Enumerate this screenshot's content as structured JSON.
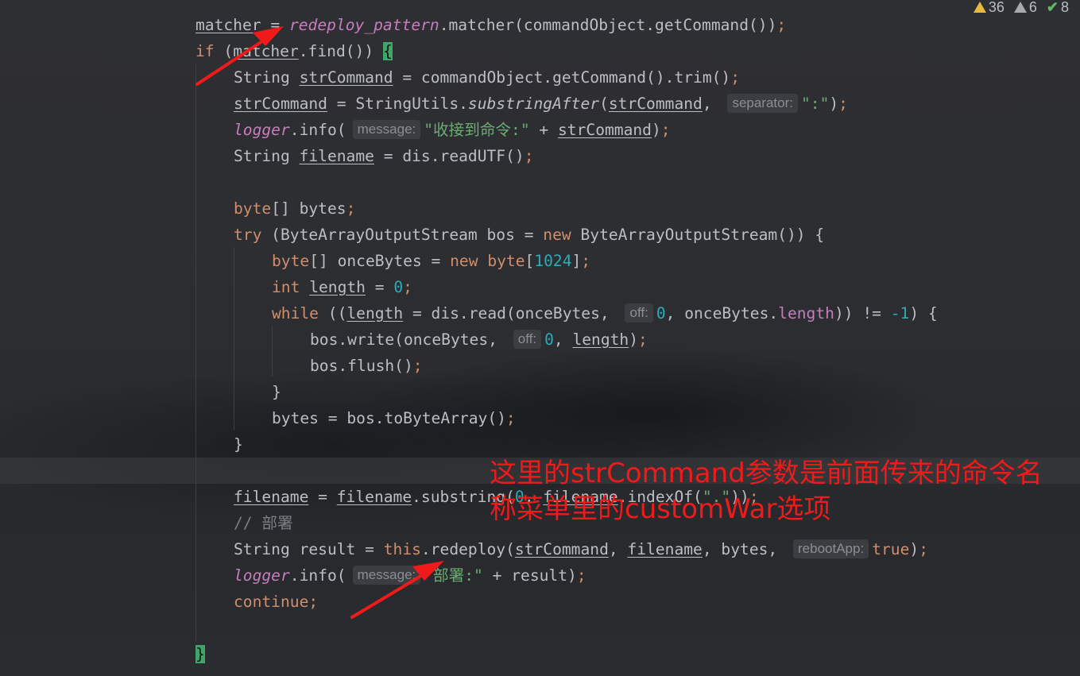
{
  "inspections": {
    "warnings": "36",
    "weak_warnings": "6",
    "typos": "8",
    "colors": {
      "warning": "#e8b93f",
      "weak": "#a7a9ad",
      "ok": "#5fb865"
    }
  },
  "code": {
    "l1": {
      "a": "matcher",
      "b": " = ",
      "c": "redeploy_pattern",
      "d": ".matcher(commandObject.getCommand())",
      "e": ";"
    },
    "l2": {
      "a": "if",
      "b": " (",
      "c": "matcher",
      "d": ".find()) ",
      "e": "{"
    },
    "l3": {
      "a": "String ",
      "b": "strCommand",
      "c": " = commandObject.getCommand().trim()",
      "d": ";"
    },
    "l4": {
      "a": "strCommand",
      "b": " = StringUtils.",
      "c": "substringAfter",
      "d": "(",
      "e": "strCommand",
      "f": ", ",
      "hint": "separator:",
      "g": "\":\"",
      "h": ")",
      "i": ";"
    },
    "l5": {
      "a": "logger",
      "b": ".info(",
      "hint": "message:",
      "c": "\"收接到命令:\"",
      "d": " + ",
      "e": "strCommand",
      "f": ")",
      "g": ";"
    },
    "l6": {
      "a": "String ",
      "b": "filename",
      "c": " = dis.readUTF()",
      "d": ";"
    },
    "l7": {
      "a": "byte",
      "b": "[] bytes",
      "c": ";"
    },
    "l8": {
      "a": "try",
      "b": " (ByteArrayOutputStream bos = ",
      "c": "new",
      "d": " ByteArrayOutputStream()) {"
    },
    "l9": {
      "a": "byte",
      "b": "[] onceBytes = ",
      "c": "new",
      "d": " ",
      "e": "byte",
      "f": "[",
      "g": "1024",
      "h": "]",
      "i": ";"
    },
    "l10": {
      "a": "int",
      "b": " ",
      "c": "length",
      "d": " = ",
      "e": "0",
      "f": ";"
    },
    "l11": {
      "a": "while",
      "b": " ((",
      "c": "length",
      "d": " = dis.read(onceBytes, ",
      "hint": "off:",
      "e": "0",
      "f": ", onceBytes.",
      "g": "length",
      "h": ")) != ",
      "i": "-1",
      "j": ") {"
    },
    "l12": {
      "a": "bos.write(onceBytes, ",
      "hint": "off:",
      "b": "0",
      "c": ", ",
      "d": "length",
      "e": ")",
      "f": ";"
    },
    "l13": {
      "a": "bos.flush()",
      "b": ";"
    },
    "l14": {
      "a": "}"
    },
    "l15": {
      "a": "bytes = bos.toByteArray()",
      "b": ";"
    },
    "l16": {
      "a": "}"
    },
    "l17": {
      "a": "filename",
      "b": " = ",
      "c": "filename",
      "d": ".substring(",
      "e": "0",
      "f": ", ",
      "g": "filename",
      "h": ".indexOf(",
      "i": "\".\"",
      "j": "))",
      "k": ";"
    },
    "l18": {
      "a": "// 部署"
    },
    "l19": {
      "a": "String result = ",
      "b": "this",
      "c": ".redeploy(",
      "d": "strCommand",
      "e": ", ",
      "f": "filename",
      "g": ", bytes, ",
      "hint": "rebootApp:",
      "h": "true",
      "i": ")",
      "j": ";"
    },
    "l20": {
      "a": "logger",
      "b": ".info(",
      "hint": "message:",
      "c": "\"部署:\"",
      "d": " + result)",
      "e": ";"
    },
    "l21": {
      "a": "continue",
      "b": ";"
    },
    "l22": {
      "a": "}"
    }
  },
  "annotation": {
    "line1": "这里的strCommand参数是前面传来的命令名",
    "line2": "称菜单里的customWar选项",
    "color": "#f01a1a"
  }
}
